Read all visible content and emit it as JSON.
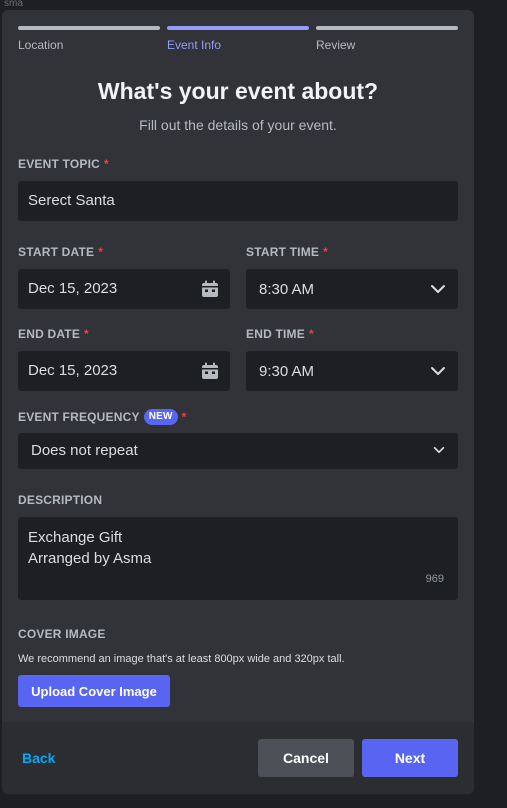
{
  "background": {
    "corner_text": "sma"
  },
  "steps": [
    {
      "label": "Location",
      "active": false
    },
    {
      "label": "Event Info",
      "active": true
    },
    {
      "label": "Review",
      "active": false
    }
  ],
  "header": {
    "title": "What's your event about?",
    "subtitle": "Fill out the details of your event."
  },
  "required_marker": "*",
  "event_topic": {
    "label": "EVENT TOPIC",
    "value": "Serect Santa"
  },
  "start_date": {
    "label": "START DATE",
    "value": "Dec 15, 2023"
  },
  "start_time": {
    "label": "START TIME",
    "value": "8:30 AM"
  },
  "end_date": {
    "label": "END DATE",
    "value": "Dec 15, 2023"
  },
  "end_time": {
    "label": "END TIME",
    "value": "9:30 AM"
  },
  "frequency": {
    "label": "EVENT FREQUENCY",
    "badge": "NEW",
    "value": "Does not repeat"
  },
  "description": {
    "label": "DESCRIPTION",
    "lines": [
      "Exchange Gift",
      "Arranged by Asma"
    ],
    "remaining": "969"
  },
  "cover_image": {
    "label": "COVER IMAGE",
    "hint": "We recommend an image that's at least 800px wide and 320px tall.",
    "button": "Upload Cover Image"
  },
  "footer": {
    "back": "Back",
    "cancel": "Cancel",
    "next": "Next"
  },
  "icons": {
    "date": "calendar-icon",
    "select": "chevron-down-icon"
  },
  "colors": {
    "accent": "#5865f2",
    "active_step": "#949cf7",
    "required": "#f23f43",
    "link": "#00a8fc"
  }
}
